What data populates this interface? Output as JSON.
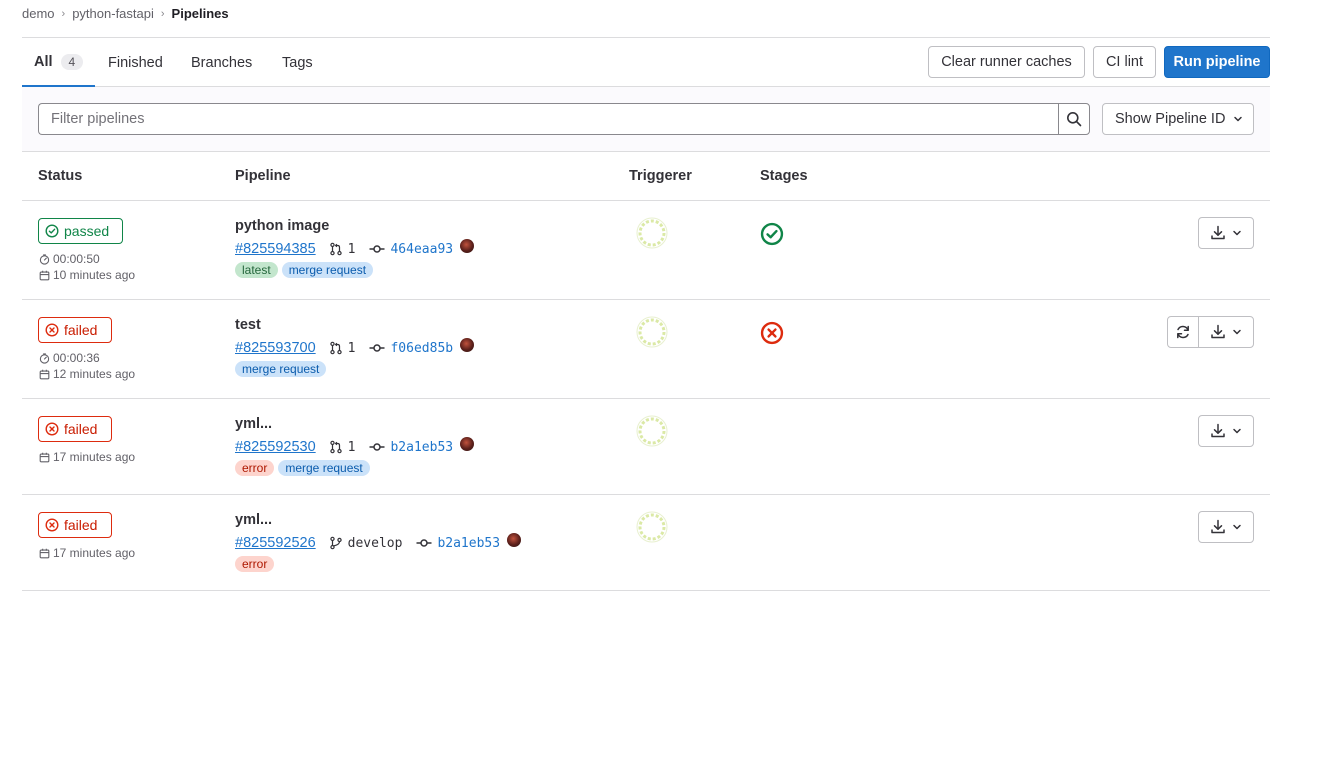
{
  "breadcrumb": [
    "demo",
    "python-fastapi",
    "Pipelines"
  ],
  "tabs": [
    {
      "label": "All",
      "count": "4"
    },
    {
      "label": "Finished"
    },
    {
      "label": "Branches"
    },
    {
      "label": "Tags"
    }
  ],
  "actions": {
    "clear_caches": "Clear runner caches",
    "ci_lint": "CI lint",
    "run_pipeline": "Run pipeline"
  },
  "filter": {
    "placeholder": "Filter pipelines",
    "show_id": "Show Pipeline ID"
  },
  "columns": [
    "Status",
    "Pipeline",
    "Triggerer",
    "Stages"
  ],
  "pipelines": [
    {
      "status": "passed",
      "duration": "00:00:50",
      "finished": "10 minutes ago",
      "title": "python image",
      "id": "#825594385",
      "mr_count": "1",
      "ref": "",
      "sha": "464eaa93",
      "tags": [
        "latest",
        "merge request"
      ],
      "stage": "passed"
    },
    {
      "status": "failed",
      "duration": "00:00:36",
      "finished": "12 minutes ago",
      "title": "test",
      "id": "#825593700",
      "mr_count": "1",
      "ref": "",
      "sha": "f06ed85b",
      "tags": [
        "merge request"
      ],
      "stage": "failed"
    },
    {
      "status": "failed",
      "duration": "",
      "finished": "17 minutes ago",
      "title": "yml...",
      "id": "#825592530",
      "mr_count": "1",
      "ref": "",
      "sha": "b2a1eb53",
      "tags": [
        "error",
        "merge request"
      ],
      "stage": ""
    },
    {
      "status": "failed",
      "duration": "",
      "finished": "17 minutes ago",
      "title": "yml...",
      "id": "#825592526",
      "mr_count": "",
      "ref": "develop",
      "sha": "b2a1eb53",
      "tags": [
        "error"
      ],
      "stage": ""
    }
  ],
  "colors": {
    "accent": "#1f75cb",
    "success": "#108548",
    "danger": "#dd2b0e"
  }
}
